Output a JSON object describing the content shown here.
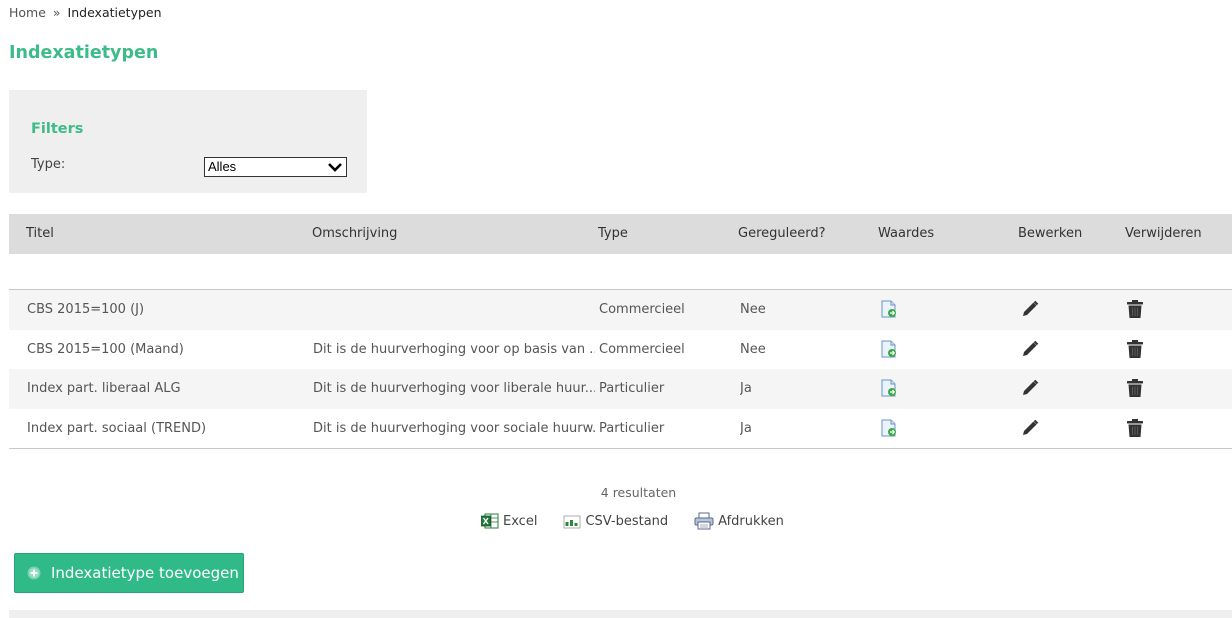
{
  "breadcrumb": {
    "home": "Home",
    "separator": "»",
    "current": "Indexatietypen"
  },
  "page": {
    "title": "Indexatietypen"
  },
  "filters": {
    "title": "Filters",
    "type_label": "Type:",
    "type_value": "Alles"
  },
  "table": {
    "headers": {
      "titel": "Titel",
      "omschrijving": "Omschrijving",
      "type": "Type",
      "gereguleerd": "Gereguleerd?",
      "waardes": "Waardes",
      "bewerken": "Bewerken",
      "verwijderen": "Verwijderen"
    },
    "rows": [
      {
        "titel": "CBS 2015=100 (J)",
        "omschrijving": "",
        "type": "Commercieel",
        "gereguleerd": "Nee"
      },
      {
        "titel": "CBS 2015=100 (Maand)",
        "omschrijving": "Dit is de huurverhoging voor op basis van ...",
        "type": "Commercieel",
        "gereguleerd": "Nee"
      },
      {
        "titel": "Index part. liberaal ALG",
        "omschrijving": "Dit is de huurverhoging voor liberale huur...",
        "type": "Particulier",
        "gereguleerd": "Ja"
      },
      {
        "titel": "Index part. sociaal (TREND)",
        "omschrijving": "Dit is de huurverhoging voor sociale huurw...",
        "type": "Particulier",
        "gereguleerd": "Ja"
      }
    ]
  },
  "results": {
    "count_text": "4 resultaten"
  },
  "exports": {
    "excel": "Excel",
    "csv": "CSV-bestand",
    "print": "Afdrukken"
  },
  "actions": {
    "add_label": "Indexatietype toevoegen"
  },
  "colors": {
    "accent": "#3dbb8a",
    "button": "#2fba88",
    "header_bg": "#dcdcdc",
    "filter_bg": "#efefef"
  }
}
